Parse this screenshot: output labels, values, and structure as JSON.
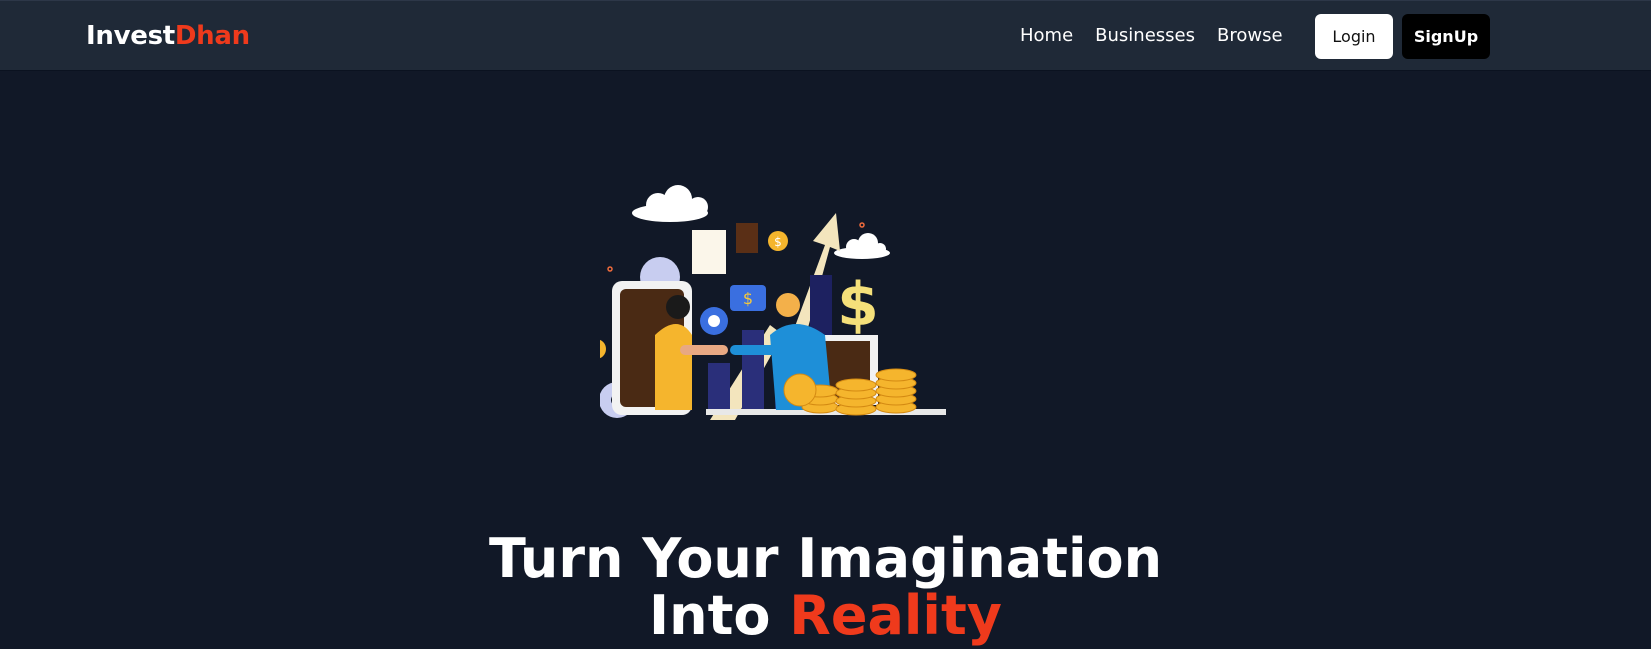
{
  "brand": {
    "part1": "Invest",
    "part2": "Dhan",
    "accent_color": "#ef3a1c"
  },
  "nav": {
    "links": [
      "Home",
      "Businesses",
      "Browse"
    ],
    "login_label": "Login",
    "signup_label": "SignUp"
  },
  "hero": {
    "illustration": "business-handshake-illustration",
    "headline_line1": "Turn Your Imagination",
    "headline_line2_start": "Into ",
    "headline_line2_accent": "Reality"
  },
  "colors": {
    "background": "#111827",
    "navbar": "#1f2937",
    "accent": "#ef3a1c"
  }
}
